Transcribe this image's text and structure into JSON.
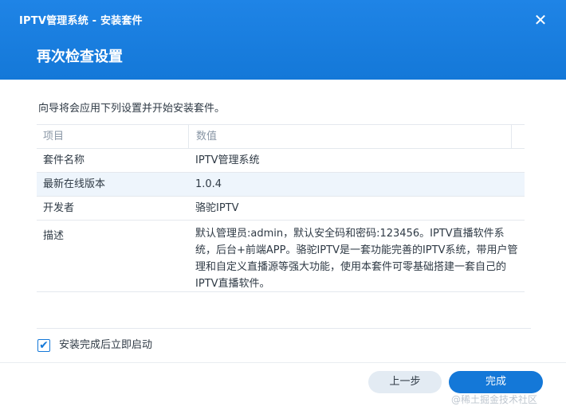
{
  "window": {
    "title": "IPTV管理系统 - 安装套件",
    "close_symbol": "✕"
  },
  "page": {
    "title": "再次检查设置",
    "intro": "向导将会应用下列设置并开始安装套件。"
  },
  "table": {
    "headers": [
      "项目",
      "数值"
    ],
    "rows": [
      {
        "label": "套件名称",
        "value": "IPTV管理系统"
      },
      {
        "label": "最新在线版本",
        "value": "1.0.4"
      },
      {
        "label": "开发者",
        "value": "骆驼IPTV"
      },
      {
        "label": "描述",
        "value": "默认管理员:admin，默认安全码和密码:123456。IPTV直播软件系统，后台+前端APP。骆驼IPTV是一套功能完善的IPTV系统，带用户管理和自定义直播源等强大功能，使用本套件可零基础搭建一套自己的IPTV直播软件。"
      }
    ]
  },
  "options": {
    "auto_start_label": "安装完成后立即启动",
    "auto_start_checked": true,
    "check_symbol": "✔"
  },
  "buttons": {
    "back": "上一步",
    "finish": "完成"
  },
  "watermark": "@稀土掘金技术社区",
  "colors": {
    "accent": "#1478d8",
    "row_highlight": "#eef5fc"
  }
}
